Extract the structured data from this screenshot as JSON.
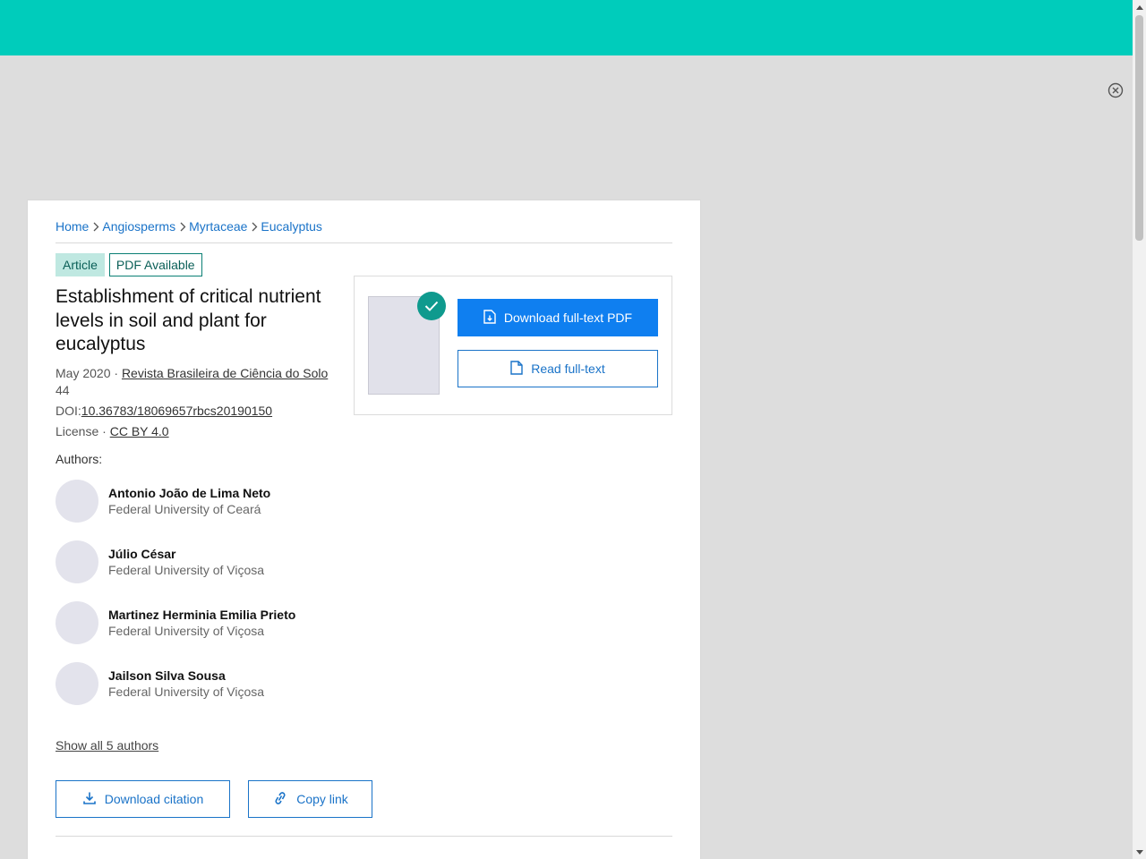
{
  "breadcrumb": [
    "Home",
    "Angiosperms",
    "Myrtaceae",
    "Eucalyptus"
  ],
  "badges": {
    "type": "Article",
    "availability": "PDF Available"
  },
  "article": {
    "title": "Establishment of critical nutrient levels in soil and plant for eucalyptus",
    "date": "May 2020",
    "date_sep": " · ",
    "journal": "Revista Brasileira de Ciência do Solo",
    "volume": "44",
    "doi_label": "DOI:",
    "doi": "10.36783/18069657rbcs20190150",
    "license_label": "License · ",
    "license": "CC BY 4.0"
  },
  "authors_label": "Authors:",
  "authors": [
    {
      "name": "Antonio João de Lima Neto",
      "institution": "Federal University of Ceará"
    },
    {
      "name": "Júlio César",
      "institution": "Federal University of Viçosa"
    },
    {
      "name": "Martinez Herminia Emilia Prieto",
      "institution": "Federal University of Viçosa"
    },
    {
      "name": "Jailson Silva Sousa",
      "institution": "Federal University of Viçosa"
    }
  ],
  "show_all_authors": "Show all 5 authors",
  "actions": {
    "download_citation": "Download citation",
    "copy_link": "Copy link"
  },
  "pdf_panel": {
    "download_pdf": "Download full-text PDF",
    "read_fulltext": "Read full-text"
  },
  "colors": {
    "header": "#00ccbb",
    "primary": "#0f7ff0",
    "link": "#1a73c8",
    "teal": "#0f9a8e"
  },
  "icons": [
    "close-circle-icon",
    "chevron-right-icon",
    "file-download-icon",
    "file-icon",
    "download-icon",
    "link-icon",
    "check-icon"
  ]
}
